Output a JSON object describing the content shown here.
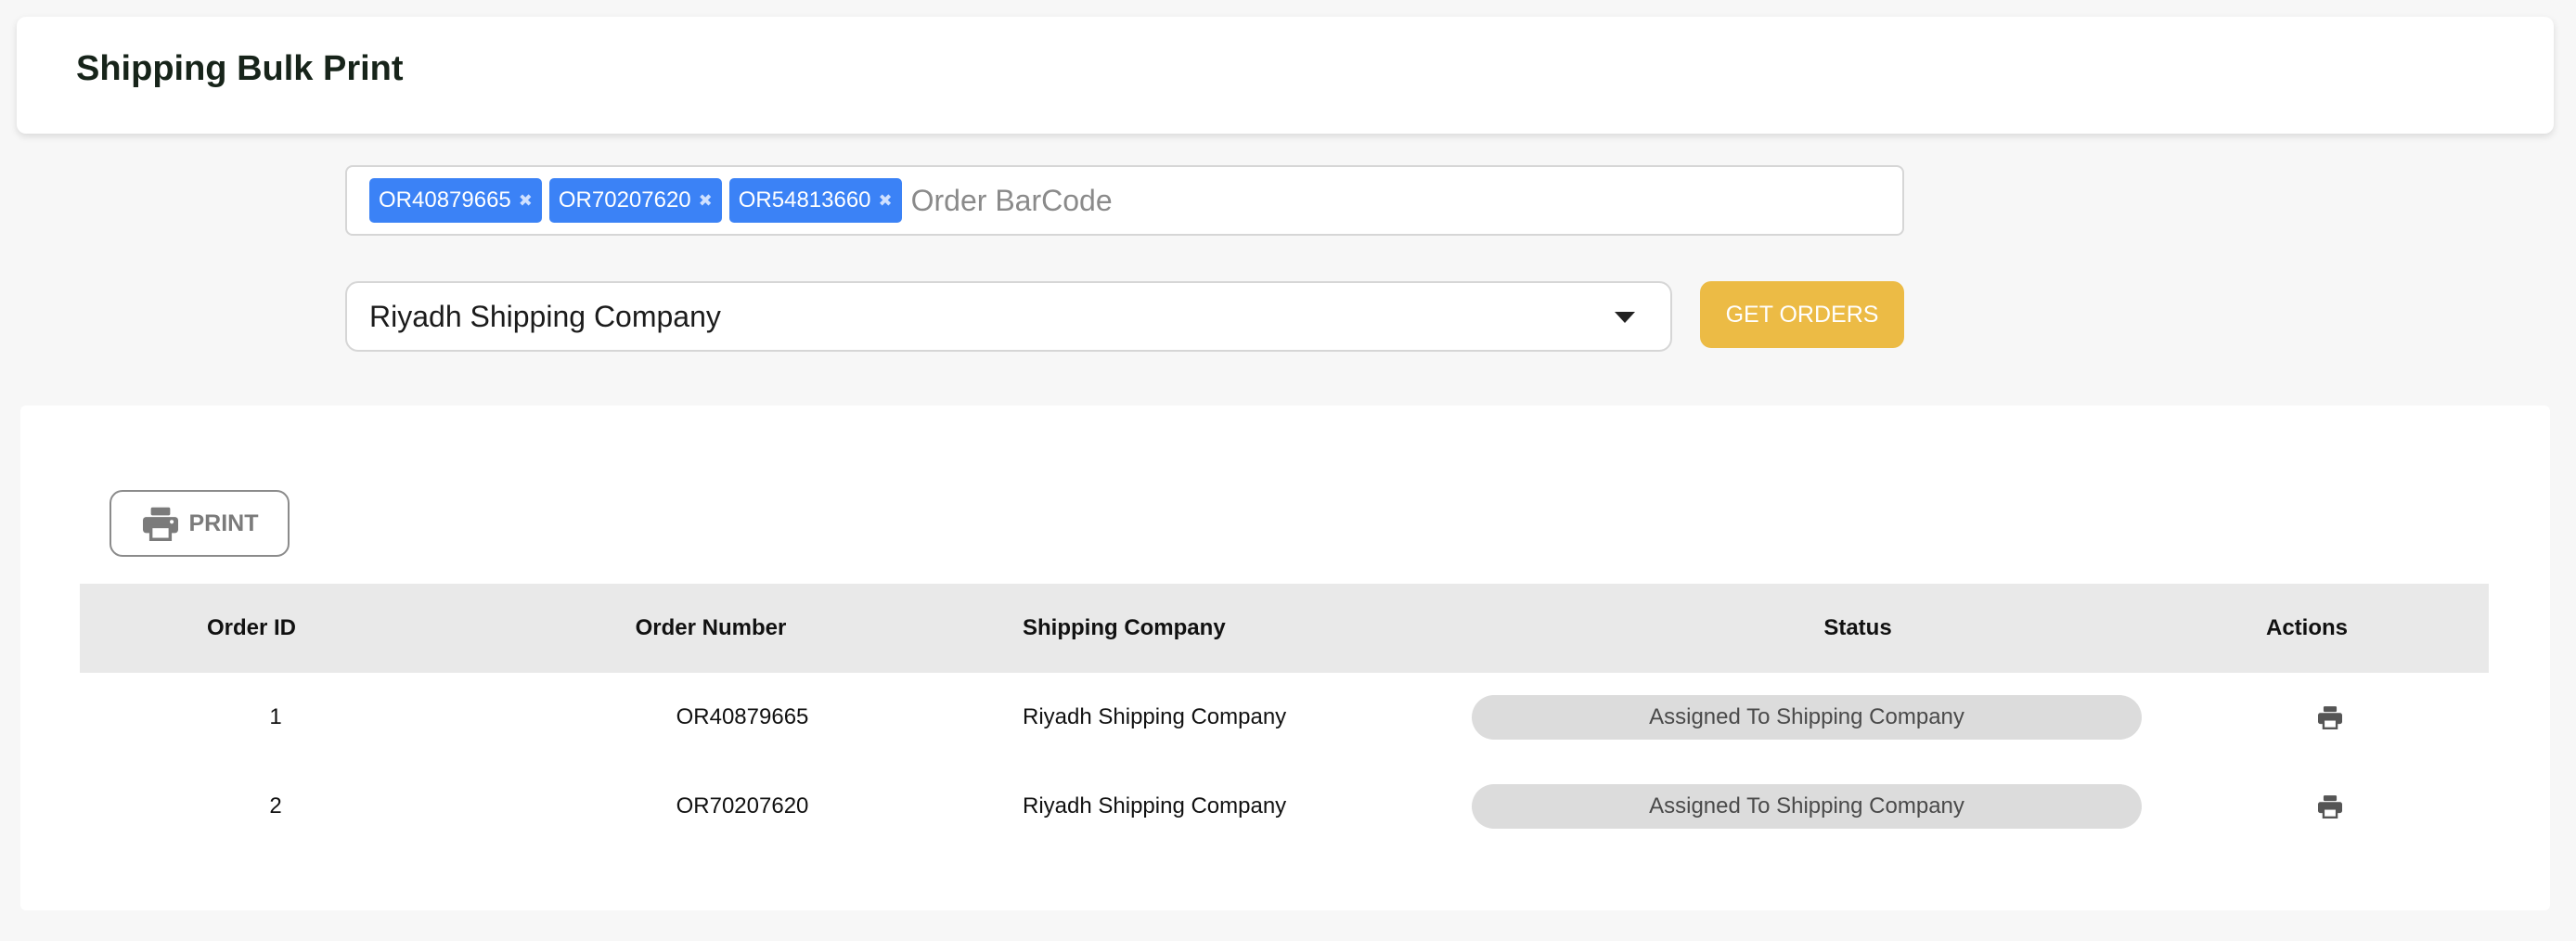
{
  "header": {
    "title": "Shipping Bulk Print"
  },
  "barcode_field": {
    "chips": [
      "OR40879665",
      "OR70207620",
      "OR54813660"
    ],
    "placeholder": "Order BarCode",
    "value": ""
  },
  "company_select": {
    "selected": "Riyadh Shipping Company"
  },
  "get_orders_button": {
    "label": "GET ORDERS"
  },
  "print_button": {
    "label": "PRINT",
    "icon": "printer-icon"
  },
  "table": {
    "columns": [
      "Order ID",
      "Order Number",
      "Shipping Company",
      "Status",
      "Actions"
    ],
    "rows": [
      {
        "id": "1",
        "number": "OR40879665",
        "company": "Riyadh Shipping Company",
        "status": "Assigned To Shipping Company"
      },
      {
        "id": "2",
        "number": "OR70207620",
        "company": "Riyadh Shipping Company",
        "status": "Assigned To Shipping Company"
      }
    ]
  },
  "colors": {
    "chip": "#3b82f6",
    "accent_button": "#ecbb45",
    "status_pill": "#dcdcdc",
    "table_header": "#e9e9e9"
  }
}
